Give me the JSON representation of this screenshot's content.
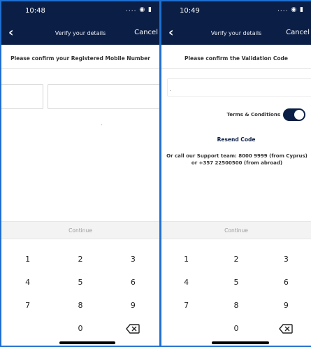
{
  "left": {
    "status_time": "10:48",
    "status_icons": ".... ◉ ▮",
    "nav": {
      "back": "‹",
      "title": "Verify your details",
      "cancel": "Cancel"
    },
    "prompt": "Please confirm your Registered Mobile Number",
    "country_code_value": "",
    "mobile_value": "",
    "continue_label": "Continue",
    "keys": [
      "1",
      "2",
      "3",
      "4",
      "5",
      "6",
      "7",
      "8",
      "9",
      "",
      "0",
      "backspace"
    ]
  },
  "right": {
    "status_time": "10:49",
    "status_icons": ".... ◉ ▮",
    "nav": {
      "back": "‹",
      "title": "Verify your details",
      "cancel": "Cancel"
    },
    "prompt": "Please confirm the Validation Code",
    "code_value": "",
    "terms_label": "Terms & Conditions",
    "terms_enabled": true,
    "resend_label": "Resend Code",
    "support_text": "Or call our Support team: 8000 9999 (from Cyprus) or +357 22500500 (from abroad)",
    "continue_label": "Continue",
    "keys": [
      "1",
      "2",
      "3",
      "4",
      "5",
      "6",
      "7",
      "8",
      "9",
      "",
      "0",
      "backspace"
    ]
  },
  "colors": {
    "navy": "#0b1e45",
    "accent_border": "#1e6fd0"
  },
  "icons": {
    "back": "chevron-left-icon",
    "backspace": "backspace-icon",
    "toggle": "toggle-switch-on"
  }
}
